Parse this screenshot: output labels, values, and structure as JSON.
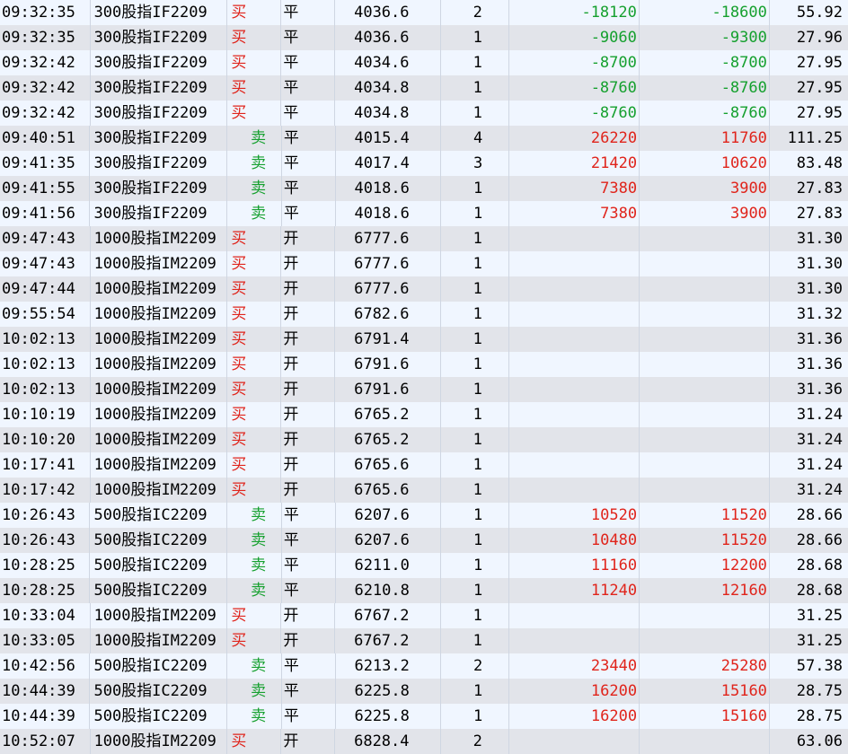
{
  "colors": {
    "buy": "#e0241b",
    "sell": "#15a02e",
    "row_light": "#f0f6ff",
    "row_dark": "#e2e4ea"
  },
  "rows": [
    {
      "time": "09:32:35",
      "name": "300股指IF2209",
      "side": "买",
      "oc": "平",
      "price": "4036.6",
      "qty": "2",
      "pnl1": "-18120",
      "pnl2": "-18600",
      "fee": "55.92"
    },
    {
      "time": "09:32:35",
      "name": "300股指IF2209",
      "side": "买",
      "oc": "平",
      "price": "4036.6",
      "qty": "1",
      "pnl1": "-9060",
      "pnl2": "-9300",
      "fee": "27.96"
    },
    {
      "time": "09:32:42",
      "name": "300股指IF2209",
      "side": "买",
      "oc": "平",
      "price": "4034.6",
      "qty": "1",
      "pnl1": "-8700",
      "pnl2": "-8700",
      "fee": "27.95"
    },
    {
      "time": "09:32:42",
      "name": "300股指IF2209",
      "side": "买",
      "oc": "平",
      "price": "4034.8",
      "qty": "1",
      "pnl1": "-8760",
      "pnl2": "-8760",
      "fee": "27.95"
    },
    {
      "time": "09:32:42",
      "name": "300股指IF2209",
      "side": "买",
      "oc": "平",
      "price": "4034.8",
      "qty": "1",
      "pnl1": "-8760",
      "pnl2": "-8760",
      "fee": "27.95"
    },
    {
      "time": "09:40:51",
      "name": "300股指IF2209",
      "side": "卖",
      "oc": "平",
      "price": "4015.4",
      "qty": "4",
      "pnl1": "26220",
      "pnl2": "11760",
      "fee": "111.25"
    },
    {
      "time": "09:41:35",
      "name": "300股指IF2209",
      "side": "卖",
      "oc": "平",
      "price": "4017.4",
      "qty": "3",
      "pnl1": "21420",
      "pnl2": "10620",
      "fee": "83.48"
    },
    {
      "time": "09:41:55",
      "name": "300股指IF2209",
      "side": "卖",
      "oc": "平",
      "price": "4018.6",
      "qty": "1",
      "pnl1": "7380",
      "pnl2": "3900",
      "fee": "27.83"
    },
    {
      "time": "09:41:56",
      "name": "300股指IF2209",
      "side": "卖",
      "oc": "平",
      "price": "4018.6",
      "qty": "1",
      "pnl1": "7380",
      "pnl2": "3900",
      "fee": "27.83"
    },
    {
      "time": "09:47:43",
      "name": "1000股指IM2209",
      "side": "买",
      "oc": "开",
      "price": "6777.6",
      "qty": "1",
      "pnl1": "",
      "pnl2": "",
      "fee": "31.30"
    },
    {
      "time": "09:47:43",
      "name": "1000股指IM2209",
      "side": "买",
      "oc": "开",
      "price": "6777.6",
      "qty": "1",
      "pnl1": "",
      "pnl2": "",
      "fee": "31.30"
    },
    {
      "time": "09:47:44",
      "name": "1000股指IM2209",
      "side": "买",
      "oc": "开",
      "price": "6777.6",
      "qty": "1",
      "pnl1": "",
      "pnl2": "",
      "fee": "31.30"
    },
    {
      "time": "09:55:54",
      "name": "1000股指IM2209",
      "side": "买",
      "oc": "开",
      "price": "6782.6",
      "qty": "1",
      "pnl1": "",
      "pnl2": "",
      "fee": "31.32"
    },
    {
      "time": "10:02:13",
      "name": "1000股指IM2209",
      "side": "买",
      "oc": "开",
      "price": "6791.4",
      "qty": "1",
      "pnl1": "",
      "pnl2": "",
      "fee": "31.36"
    },
    {
      "time": "10:02:13",
      "name": "1000股指IM2209",
      "side": "买",
      "oc": "开",
      "price": "6791.6",
      "qty": "1",
      "pnl1": "",
      "pnl2": "",
      "fee": "31.36"
    },
    {
      "time": "10:02:13",
      "name": "1000股指IM2209",
      "side": "买",
      "oc": "开",
      "price": "6791.6",
      "qty": "1",
      "pnl1": "",
      "pnl2": "",
      "fee": "31.36"
    },
    {
      "time": "10:10:19",
      "name": "1000股指IM2209",
      "side": "买",
      "oc": "开",
      "price": "6765.2",
      "qty": "1",
      "pnl1": "",
      "pnl2": "",
      "fee": "31.24"
    },
    {
      "time": "10:10:20",
      "name": "1000股指IM2209",
      "side": "买",
      "oc": "开",
      "price": "6765.2",
      "qty": "1",
      "pnl1": "",
      "pnl2": "",
      "fee": "31.24"
    },
    {
      "time": "10:17:41",
      "name": "1000股指IM2209",
      "side": "买",
      "oc": "开",
      "price": "6765.6",
      "qty": "1",
      "pnl1": "",
      "pnl2": "",
      "fee": "31.24"
    },
    {
      "time": "10:17:42",
      "name": "1000股指IM2209",
      "side": "买",
      "oc": "开",
      "price": "6765.6",
      "qty": "1",
      "pnl1": "",
      "pnl2": "",
      "fee": "31.24"
    },
    {
      "time": "10:26:43",
      "name": "500股指IC2209",
      "side": "卖",
      "oc": "平",
      "price": "6207.6",
      "qty": "1",
      "pnl1": "10520",
      "pnl2": "11520",
      "fee": "28.66"
    },
    {
      "time": "10:26:43",
      "name": "500股指IC2209",
      "side": "卖",
      "oc": "平",
      "price": "6207.6",
      "qty": "1",
      "pnl1": "10480",
      "pnl2": "11520",
      "fee": "28.66"
    },
    {
      "time": "10:28:25",
      "name": "500股指IC2209",
      "side": "卖",
      "oc": "平",
      "price": "6211.0",
      "qty": "1",
      "pnl1": "11160",
      "pnl2": "12200",
      "fee": "28.68"
    },
    {
      "time": "10:28:25",
      "name": "500股指IC2209",
      "side": "卖",
      "oc": "平",
      "price": "6210.8",
      "qty": "1",
      "pnl1": "11240",
      "pnl2": "12160",
      "fee": "28.68"
    },
    {
      "time": "10:33:04",
      "name": "1000股指IM2209",
      "side": "买",
      "oc": "开",
      "price": "6767.2",
      "qty": "1",
      "pnl1": "",
      "pnl2": "",
      "fee": "31.25"
    },
    {
      "time": "10:33:05",
      "name": "1000股指IM2209",
      "side": "买",
      "oc": "开",
      "price": "6767.2",
      "qty": "1",
      "pnl1": "",
      "pnl2": "",
      "fee": "31.25"
    },
    {
      "time": "10:42:56",
      "name": "500股指IC2209",
      "side": "卖",
      "oc": "平",
      "price": "6213.2",
      "qty": "2",
      "pnl1": "23440",
      "pnl2": "25280",
      "fee": "57.38"
    },
    {
      "time": "10:44:39",
      "name": "500股指IC2209",
      "side": "卖",
      "oc": "平",
      "price": "6225.8",
      "qty": "1",
      "pnl1": "16200",
      "pnl2": "15160",
      "fee": "28.75"
    },
    {
      "time": "10:44:39",
      "name": "500股指IC2209",
      "side": "卖",
      "oc": "平",
      "price": "6225.8",
      "qty": "1",
      "pnl1": "16200",
      "pnl2": "15160",
      "fee": "28.75"
    },
    {
      "time": "10:52:07",
      "name": "1000股指IM2209",
      "side": "买",
      "oc": "开",
      "price": "6828.4",
      "qty": "2",
      "pnl1": "",
      "pnl2": "",
      "fee": "63.06"
    }
  ]
}
